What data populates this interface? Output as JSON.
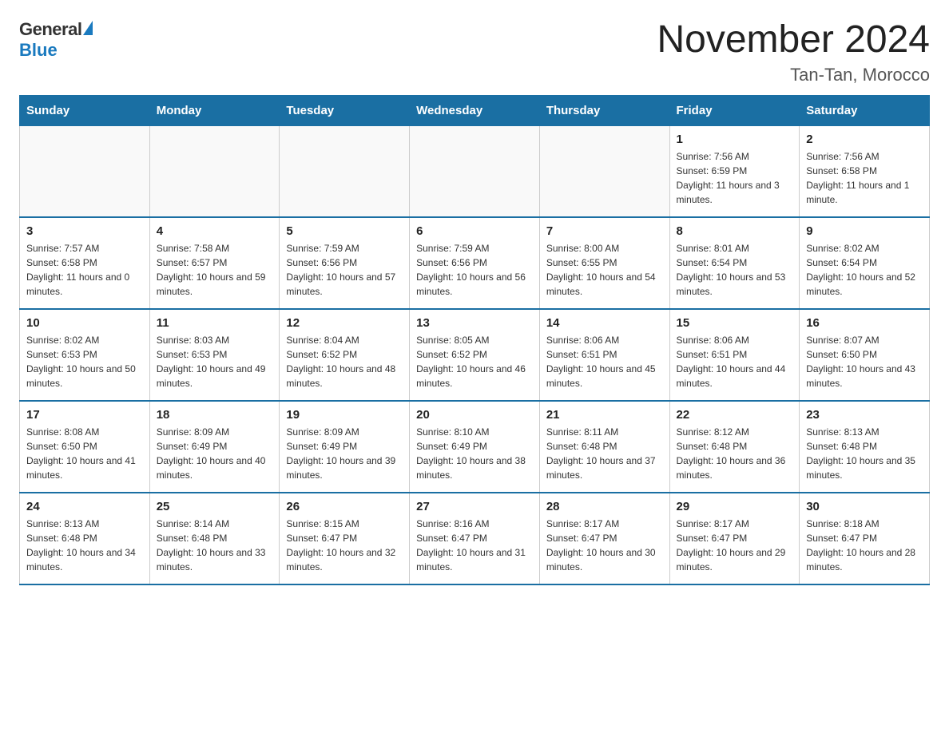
{
  "logo": {
    "general": "General",
    "blue": "Blue"
  },
  "title": "November 2024",
  "subtitle": "Tan-Tan, Morocco",
  "days_of_week": [
    "Sunday",
    "Monday",
    "Tuesday",
    "Wednesday",
    "Thursday",
    "Friday",
    "Saturday"
  ],
  "weeks": [
    [
      {
        "day": "",
        "info": ""
      },
      {
        "day": "",
        "info": ""
      },
      {
        "day": "",
        "info": ""
      },
      {
        "day": "",
        "info": ""
      },
      {
        "day": "",
        "info": ""
      },
      {
        "day": "1",
        "info": "Sunrise: 7:56 AM\nSunset: 6:59 PM\nDaylight: 11 hours and 3 minutes."
      },
      {
        "day": "2",
        "info": "Sunrise: 7:56 AM\nSunset: 6:58 PM\nDaylight: 11 hours and 1 minute."
      }
    ],
    [
      {
        "day": "3",
        "info": "Sunrise: 7:57 AM\nSunset: 6:58 PM\nDaylight: 11 hours and 0 minutes."
      },
      {
        "day": "4",
        "info": "Sunrise: 7:58 AM\nSunset: 6:57 PM\nDaylight: 10 hours and 59 minutes."
      },
      {
        "day": "5",
        "info": "Sunrise: 7:59 AM\nSunset: 6:56 PM\nDaylight: 10 hours and 57 minutes."
      },
      {
        "day": "6",
        "info": "Sunrise: 7:59 AM\nSunset: 6:56 PM\nDaylight: 10 hours and 56 minutes."
      },
      {
        "day": "7",
        "info": "Sunrise: 8:00 AM\nSunset: 6:55 PM\nDaylight: 10 hours and 54 minutes."
      },
      {
        "day": "8",
        "info": "Sunrise: 8:01 AM\nSunset: 6:54 PM\nDaylight: 10 hours and 53 minutes."
      },
      {
        "day": "9",
        "info": "Sunrise: 8:02 AM\nSunset: 6:54 PM\nDaylight: 10 hours and 52 minutes."
      }
    ],
    [
      {
        "day": "10",
        "info": "Sunrise: 8:02 AM\nSunset: 6:53 PM\nDaylight: 10 hours and 50 minutes."
      },
      {
        "day": "11",
        "info": "Sunrise: 8:03 AM\nSunset: 6:53 PM\nDaylight: 10 hours and 49 minutes."
      },
      {
        "day": "12",
        "info": "Sunrise: 8:04 AM\nSunset: 6:52 PM\nDaylight: 10 hours and 48 minutes."
      },
      {
        "day": "13",
        "info": "Sunrise: 8:05 AM\nSunset: 6:52 PM\nDaylight: 10 hours and 46 minutes."
      },
      {
        "day": "14",
        "info": "Sunrise: 8:06 AM\nSunset: 6:51 PM\nDaylight: 10 hours and 45 minutes."
      },
      {
        "day": "15",
        "info": "Sunrise: 8:06 AM\nSunset: 6:51 PM\nDaylight: 10 hours and 44 minutes."
      },
      {
        "day": "16",
        "info": "Sunrise: 8:07 AM\nSunset: 6:50 PM\nDaylight: 10 hours and 43 minutes."
      }
    ],
    [
      {
        "day": "17",
        "info": "Sunrise: 8:08 AM\nSunset: 6:50 PM\nDaylight: 10 hours and 41 minutes."
      },
      {
        "day": "18",
        "info": "Sunrise: 8:09 AM\nSunset: 6:49 PM\nDaylight: 10 hours and 40 minutes."
      },
      {
        "day": "19",
        "info": "Sunrise: 8:09 AM\nSunset: 6:49 PM\nDaylight: 10 hours and 39 minutes."
      },
      {
        "day": "20",
        "info": "Sunrise: 8:10 AM\nSunset: 6:49 PM\nDaylight: 10 hours and 38 minutes."
      },
      {
        "day": "21",
        "info": "Sunrise: 8:11 AM\nSunset: 6:48 PM\nDaylight: 10 hours and 37 minutes."
      },
      {
        "day": "22",
        "info": "Sunrise: 8:12 AM\nSunset: 6:48 PM\nDaylight: 10 hours and 36 minutes."
      },
      {
        "day": "23",
        "info": "Sunrise: 8:13 AM\nSunset: 6:48 PM\nDaylight: 10 hours and 35 minutes."
      }
    ],
    [
      {
        "day": "24",
        "info": "Sunrise: 8:13 AM\nSunset: 6:48 PM\nDaylight: 10 hours and 34 minutes."
      },
      {
        "day": "25",
        "info": "Sunrise: 8:14 AM\nSunset: 6:48 PM\nDaylight: 10 hours and 33 minutes."
      },
      {
        "day": "26",
        "info": "Sunrise: 8:15 AM\nSunset: 6:47 PM\nDaylight: 10 hours and 32 minutes."
      },
      {
        "day": "27",
        "info": "Sunrise: 8:16 AM\nSunset: 6:47 PM\nDaylight: 10 hours and 31 minutes."
      },
      {
        "day": "28",
        "info": "Sunrise: 8:17 AM\nSunset: 6:47 PM\nDaylight: 10 hours and 30 minutes."
      },
      {
        "day": "29",
        "info": "Sunrise: 8:17 AM\nSunset: 6:47 PM\nDaylight: 10 hours and 29 minutes."
      },
      {
        "day": "30",
        "info": "Sunrise: 8:18 AM\nSunset: 6:47 PM\nDaylight: 10 hours and 28 minutes."
      }
    ]
  ]
}
